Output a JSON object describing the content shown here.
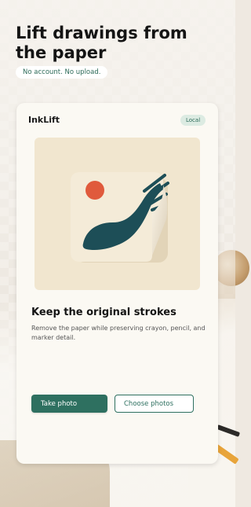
{
  "hero": {
    "title": "Lift drawings from the paper",
    "tagline": "No account. No upload."
  },
  "card": {
    "app_name": "InkLift",
    "badge": "Local",
    "feature_title": "Keep the original strokes",
    "feature_description": "Remove the paper while preserving crayon, pencil, and marker detail.",
    "primary_button": "Take photo",
    "secondary_button": "Choose photos"
  },
  "colors": {
    "accent": "#2e7060",
    "badge_bg": "#dcebe2",
    "preview_bg": "#f1e6cf",
    "sun": "#e05a3c",
    "ink": "#1d4e57"
  }
}
